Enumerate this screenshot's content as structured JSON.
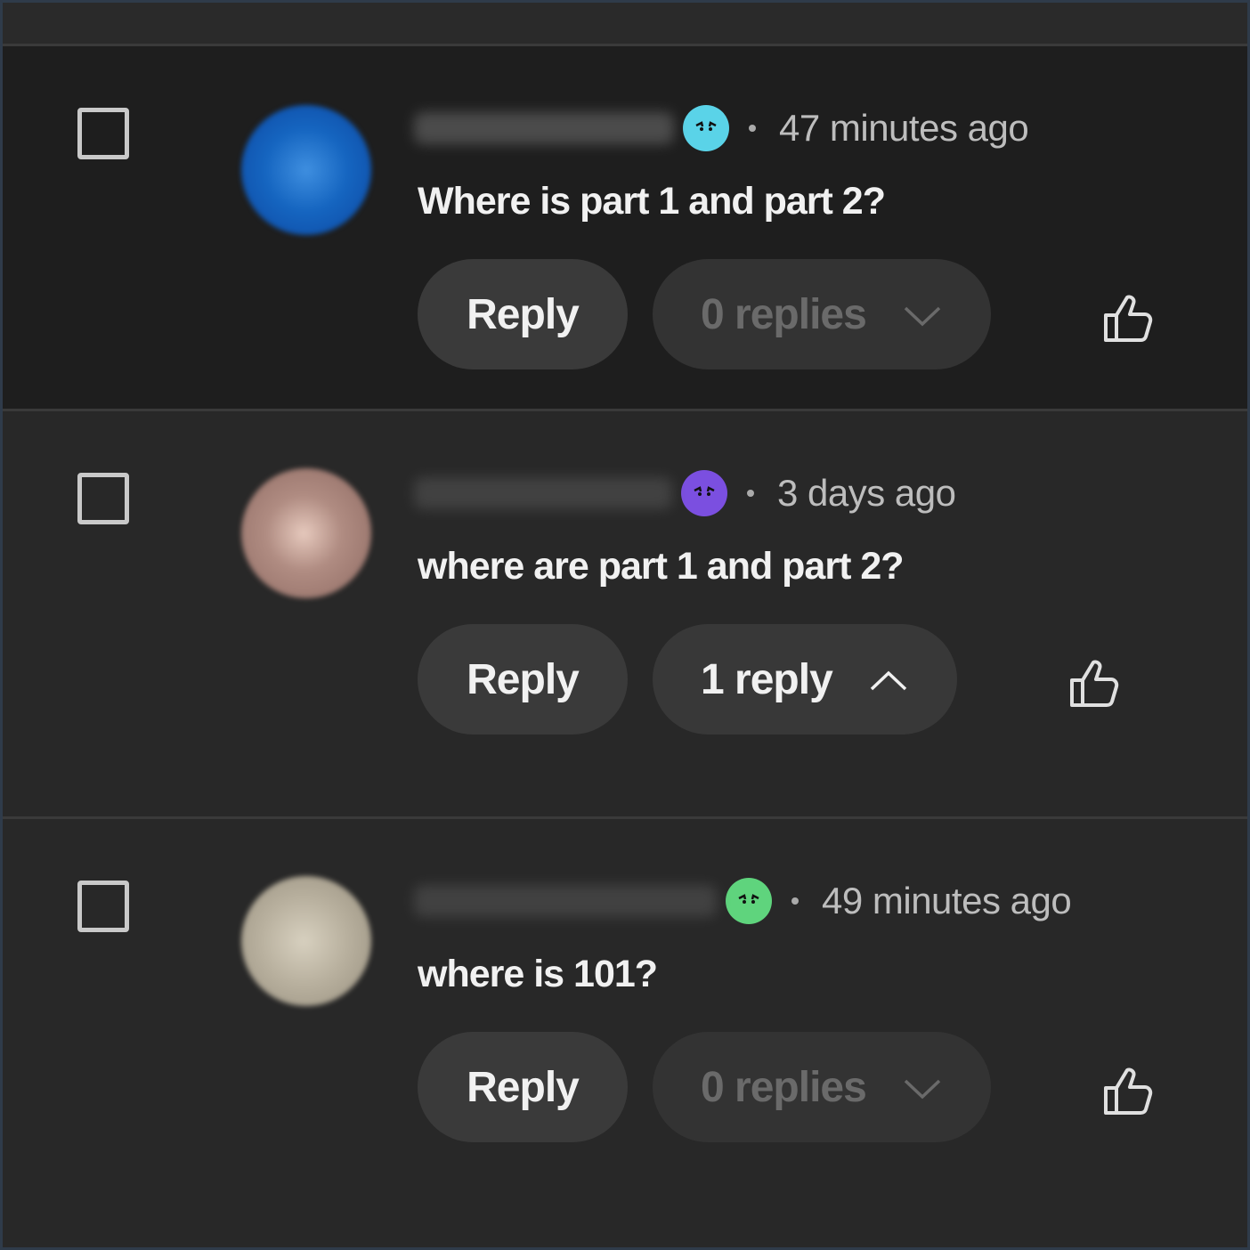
{
  "comments": [
    {
      "time": "47 minutes ago",
      "text": "Where is part 1 and part 2?",
      "reply_label": "Reply",
      "replies_label": "0 replies",
      "replies_state": "disabled",
      "badge_color": "#5ad3e8",
      "avatar_color": "#1565c0",
      "like_icon": "thumbs-up-icon"
    },
    {
      "time": "3 days ago",
      "text": "where are part 1 and part 2?",
      "reply_label": "Reply",
      "replies_label": "1 reply",
      "replies_state": "expanded",
      "badge_color": "#7b4fe0",
      "avatar_color": "#a9837a",
      "like_icon": "thumbs-up-icon"
    },
    {
      "time": "49 minutes ago",
      "text": "where is 101?",
      "reply_label": "Reply",
      "replies_label": "0 replies",
      "replies_state": "disabled",
      "badge_color": "#5fd47d",
      "avatar_color": "#b9b19f",
      "like_icon": "thumbs-up-icon"
    }
  ]
}
